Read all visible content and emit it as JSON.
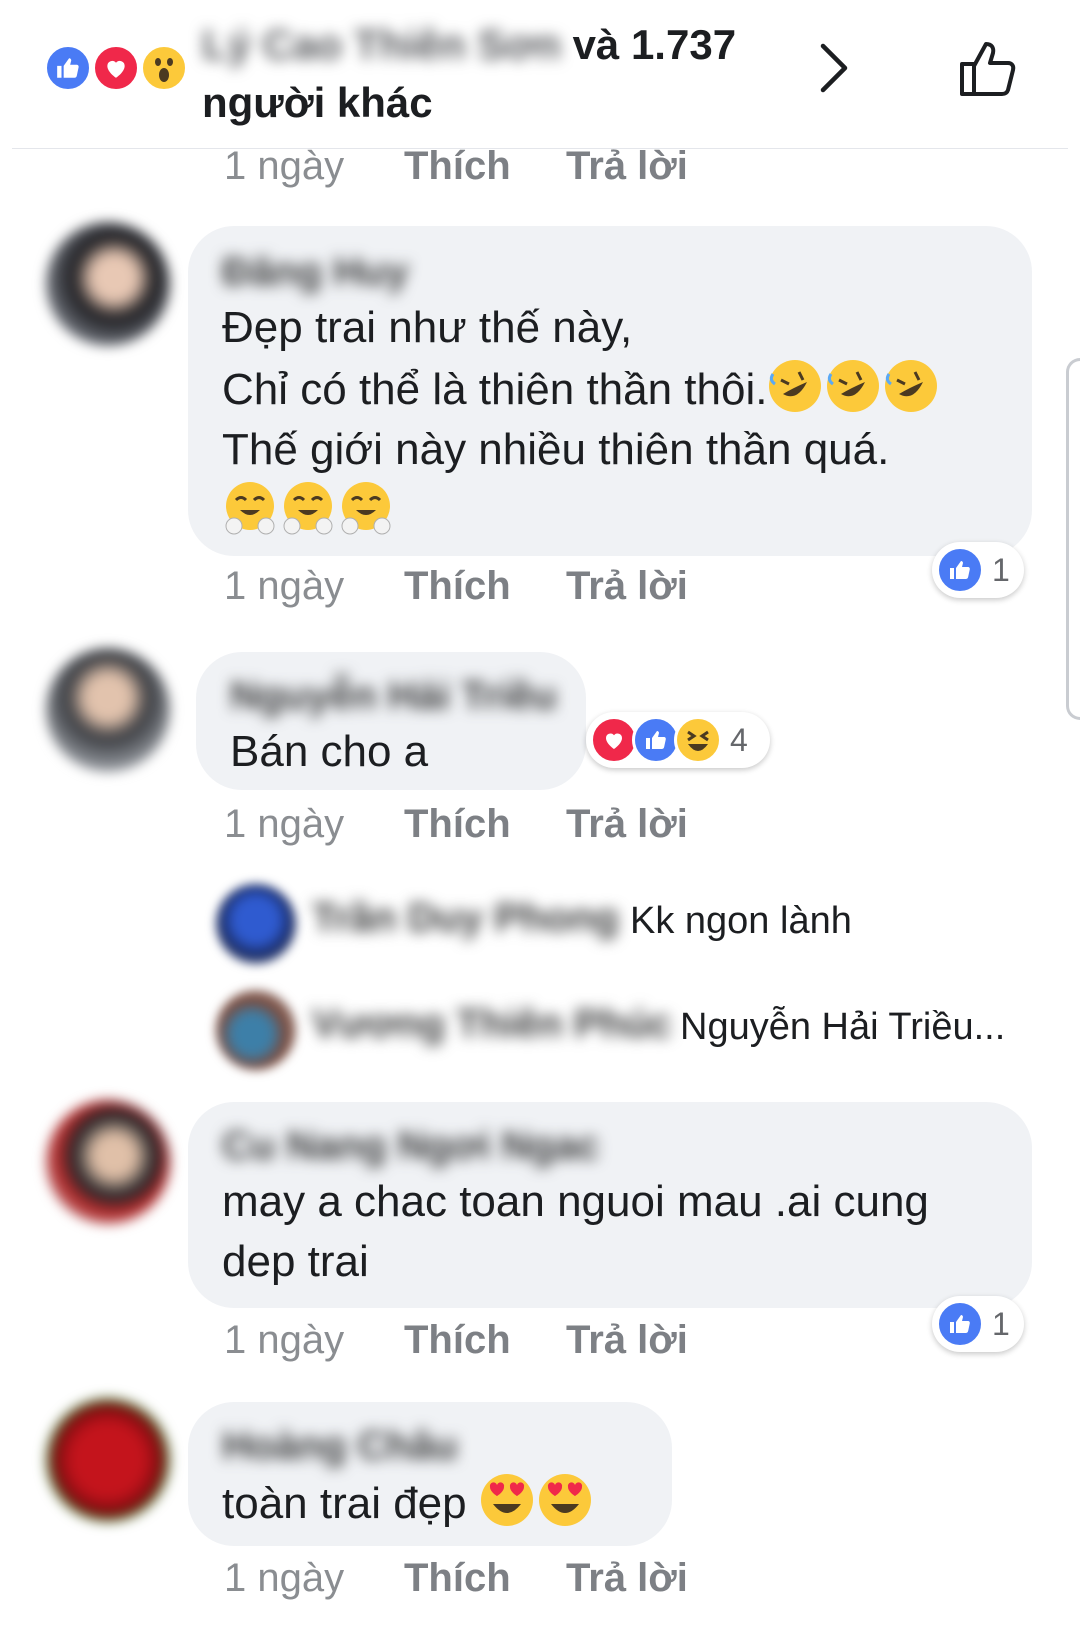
{
  "header": {
    "reactions": [
      "like-icon",
      "love-icon",
      "wow-icon"
    ],
    "names_blurred": "Lý Cao Thiên Sơn",
    "summary_suffix": "và 1.737",
    "summary_line2": "người khác"
  },
  "top_actions": {
    "time": "1 ngày",
    "like": "Thích",
    "reply": "Trả lời"
  },
  "comments": [
    {
      "name": "Đăng Huy",
      "line1": "Đẹp trai như thế này,",
      "line2": "Chỉ có thể là thiên thần thôi.",
      "line3": "Thế giới này nhiều thiên thần  quá.",
      "emoji_line2": [
        "rolling-laughing-emoji",
        "rolling-laughing-emoji",
        "rolling-laughing-emoji"
      ],
      "emoji_line4": [
        "hugging-emoji",
        "hugging-emoji",
        "hugging-emoji"
      ],
      "reactions": [
        "like-icon"
      ],
      "reaction_count": "1",
      "time": "1 ngày",
      "like": "Thích",
      "reply": "Trả lời"
    },
    {
      "name": "Nguyễn Hải Triều",
      "line1": "Bán cho a",
      "reactions": [
        "love-icon",
        "like-icon",
        "haha-icon"
      ],
      "reaction_count": "4",
      "time": "1 ngày",
      "like": "Thích",
      "reply": "Trả lời",
      "replies": [
        {
          "name": "Trần Duy Phong",
          "text": "Kk ngon lành"
        },
        {
          "name": "Vương Thiên Phúc",
          "text": "Nguyễn Hải Triều..."
        }
      ]
    },
    {
      "name": "Cu Nang Ngơi Ngac",
      "line1": "may a chac toan nguoi mau .ai cung",
      "line2": "dep trai",
      "reactions": [
        "like-icon"
      ],
      "reaction_count": "1",
      "time": "1 ngày",
      "like": "Thích",
      "reply": "Trả lời"
    },
    {
      "name": "Hoàng Châu",
      "line1": "toàn trai đẹp",
      "emoji_line1": [
        "heart-eyes-emoji",
        "heart-eyes-emoji"
      ],
      "time": "1 ngày",
      "like": "Thích",
      "reply": "Trả lời"
    }
  ],
  "colors": {
    "like_blue": "#4a7bf5",
    "love_red": "#f0284a",
    "haha_yellow": "#fcc93a",
    "bubble_gray": "#f0f2f5",
    "meta_gray": "#8a8d91"
  }
}
